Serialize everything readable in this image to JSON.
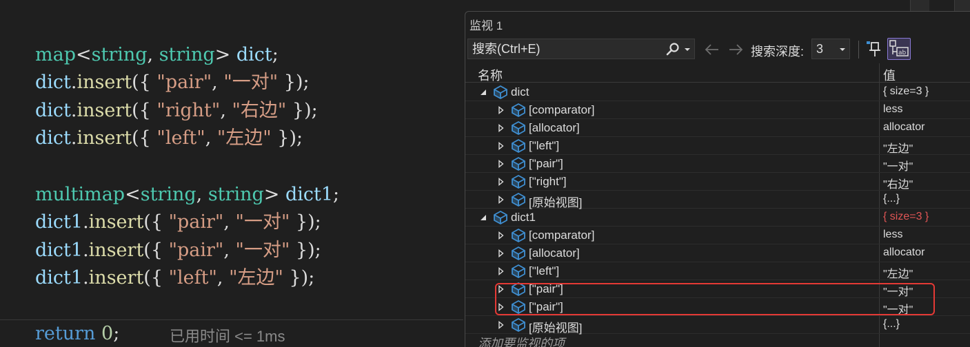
{
  "editor": {
    "lines": [
      [
        {
          "t": "map",
          "c": "type"
        },
        {
          "t": "<",
          "c": "pun"
        },
        {
          "t": "string",
          "c": "type"
        },
        {
          "t": ", ",
          "c": "pun"
        },
        {
          "t": "string",
          "c": "type"
        },
        {
          "t": "> ",
          "c": "pun"
        },
        {
          "t": "dict",
          "c": "var"
        },
        {
          "t": ";",
          "c": "pun"
        }
      ],
      [
        {
          "t": "dict",
          "c": "var"
        },
        {
          "t": ".",
          "c": "pun"
        },
        {
          "t": "insert",
          "c": "fn"
        },
        {
          "t": "({ ",
          "c": "pun"
        },
        {
          "t": "\"pair\"",
          "c": "str"
        },
        {
          "t": ", ",
          "c": "pun"
        },
        {
          "t": "\"一对\"",
          "c": "str"
        },
        {
          "t": " });",
          "c": "pun"
        }
      ],
      [
        {
          "t": "dict",
          "c": "var"
        },
        {
          "t": ".",
          "c": "pun"
        },
        {
          "t": "insert",
          "c": "fn"
        },
        {
          "t": "({ ",
          "c": "pun"
        },
        {
          "t": "\"right\"",
          "c": "str"
        },
        {
          "t": ", ",
          "c": "pun"
        },
        {
          "t": "\"右边\"",
          "c": "str"
        },
        {
          "t": " });",
          "c": "pun"
        }
      ],
      [
        {
          "t": "dict",
          "c": "var"
        },
        {
          "t": ".",
          "c": "pun"
        },
        {
          "t": "insert",
          "c": "fn"
        },
        {
          "t": "({ ",
          "c": "pun"
        },
        {
          "t": "\"left\"",
          "c": "str"
        },
        {
          "t": ", ",
          "c": "pun"
        },
        {
          "t": "\"左边\"",
          "c": "str"
        },
        {
          "t": " });",
          "c": "pun"
        }
      ],
      [],
      [
        {
          "t": "multimap",
          "c": "type"
        },
        {
          "t": "<",
          "c": "pun"
        },
        {
          "t": "string",
          "c": "type"
        },
        {
          "t": ", ",
          "c": "pun"
        },
        {
          "t": "string",
          "c": "type"
        },
        {
          "t": "> ",
          "c": "pun"
        },
        {
          "t": "dict1",
          "c": "var"
        },
        {
          "t": ";",
          "c": "pun"
        }
      ],
      [
        {
          "t": "dict1",
          "c": "var"
        },
        {
          "t": ".",
          "c": "pun"
        },
        {
          "t": "insert",
          "c": "fn"
        },
        {
          "t": "({ ",
          "c": "pun"
        },
        {
          "t": "\"pair\"",
          "c": "str"
        },
        {
          "t": ", ",
          "c": "pun"
        },
        {
          "t": "\"一对\"",
          "c": "str"
        },
        {
          "t": " });",
          "c": "pun"
        }
      ],
      [
        {
          "t": "dict1",
          "c": "var"
        },
        {
          "t": ".",
          "c": "pun"
        },
        {
          "t": "insert",
          "c": "fn"
        },
        {
          "t": "({ ",
          "c": "pun"
        },
        {
          "t": "\"pair\"",
          "c": "str"
        },
        {
          "t": ", ",
          "c": "pun"
        },
        {
          "t": "\"一对\"",
          "c": "str"
        },
        {
          "t": " });",
          "c": "pun"
        }
      ],
      [
        {
          "t": "dict1",
          "c": "var"
        },
        {
          "t": ".",
          "c": "pun"
        },
        {
          "t": "insert",
          "c": "fn"
        },
        {
          "t": "({ ",
          "c": "pun"
        },
        {
          "t": "\"left\"",
          "c": "str"
        },
        {
          "t": ", ",
          "c": "pun"
        },
        {
          "t": "\"左边\"",
          "c": "str"
        },
        {
          "t": " });",
          "c": "pun"
        }
      ],
      [],
      [
        {
          "t": "return",
          "c": "kw"
        },
        {
          "t": " ",
          "c": "pun"
        },
        {
          "t": "0",
          "c": "num"
        },
        {
          "t": ";",
          "c": "pun"
        }
      ]
    ],
    "perf_tip": "已用时间 <= 1ms"
  },
  "watch": {
    "title": "监视 1",
    "search_placeholder": "搜索(Ctrl+E)",
    "depth_label": "搜索深度:",
    "depth_value": "3",
    "columns": {
      "name": "名称",
      "value": "值"
    },
    "rows": [
      {
        "level": 0,
        "expand": "expanded",
        "name": "dict",
        "value": "{ size=3 }",
        "changed": false
      },
      {
        "level": 1,
        "expand": "collapsed",
        "name": "[comparator]",
        "value": "less",
        "changed": false
      },
      {
        "level": 1,
        "expand": "collapsed",
        "name": "[allocator]",
        "value": "allocator",
        "changed": false
      },
      {
        "level": 1,
        "expand": "collapsed",
        "name": "[\"left\"]",
        "value": "\"左边\"",
        "changed": false
      },
      {
        "level": 1,
        "expand": "collapsed",
        "name": "[\"pair\"]",
        "value": "\"一对\"",
        "changed": false
      },
      {
        "level": 1,
        "expand": "collapsed",
        "name": "[\"right\"]",
        "value": "\"右边\"",
        "changed": false
      },
      {
        "level": 1,
        "expand": "collapsed",
        "name": "[原始视图]",
        "value": "{...}",
        "changed": false
      },
      {
        "level": 0,
        "expand": "expanded",
        "name": "dict1",
        "value": "{ size=3 }",
        "changed": true
      },
      {
        "level": 1,
        "expand": "collapsed",
        "name": "[comparator]",
        "value": "less",
        "changed": false
      },
      {
        "level": 1,
        "expand": "collapsed",
        "name": "[allocator]",
        "value": "allocator",
        "changed": false
      },
      {
        "level": 1,
        "expand": "collapsed",
        "name": "[\"left\"]",
        "value": "\"左边\"",
        "changed": false
      },
      {
        "level": 1,
        "expand": "collapsed",
        "name": "[\"pair\"]",
        "value": "\"一对\"",
        "changed": false
      },
      {
        "level": 1,
        "expand": "collapsed",
        "name": "[\"pair\"]",
        "value": "\"一对\"",
        "changed": false
      },
      {
        "level": 1,
        "expand": "collapsed",
        "name": "[原始视图]",
        "value": "{...}",
        "changed": false
      }
    ],
    "add_watch_placeholder": "添加要监视的项",
    "highlighted_rows": [
      11,
      12
    ],
    "icons": {
      "search": "search-icon",
      "back": "arrow-left-icon",
      "forward": "arrow-right-icon",
      "pin": "pin-icon",
      "hex": "hex-display-icon",
      "object": "object-cube-icon"
    }
  },
  "colors": {
    "type": "#4ec9b0",
    "variable": "#9cdcfe",
    "function": "#dcdcaa",
    "string": "#d69d85",
    "keyword": "#569cd6",
    "number": "#b5cea8",
    "changed_value": "#e05555",
    "highlight": "#e53935",
    "object_icon": "#3f8fd2"
  }
}
